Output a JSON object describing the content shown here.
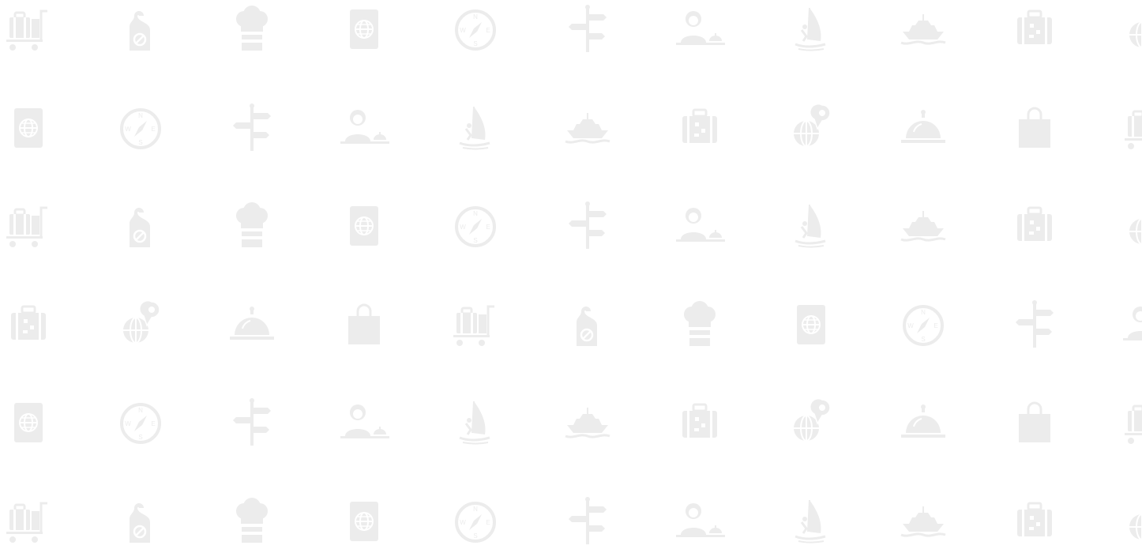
{
  "background": {
    "color": "#ffffff",
    "icon_color": "#ececec"
  },
  "rows": [
    [
      "luggage-cart-icon",
      "door-hanger-icon",
      "chef-hat-icon",
      "passport-icon",
      "compass-icon",
      "signpost-icon",
      "receptionist-icon",
      "windsurfing-icon",
      "cruise-ship-icon",
      "suitcase-icon",
      "globe-pin-icon"
    ],
    [
      "passport-icon",
      "compass-icon",
      "signpost-icon",
      "receptionist-icon",
      "windsurfing-icon",
      "cruise-ship-icon",
      "suitcase-icon",
      "globe-pin-icon",
      "room-service-cloche-icon",
      "shopping-bag-icon",
      "luggage-cart-icon"
    ],
    [
      "luggage-cart-icon",
      "door-hanger-icon",
      "chef-hat-icon",
      "passport-icon",
      "compass-icon",
      "signpost-icon",
      "receptionist-icon",
      "windsurfing-icon",
      "cruise-ship-icon",
      "suitcase-icon",
      "globe-pin-icon"
    ],
    [
      "suitcase-icon",
      "globe-pin-icon",
      "room-service-cloche-icon",
      "shopping-bag-icon",
      "luggage-cart-icon",
      "door-hanger-icon",
      "chef-hat-icon",
      "passport-icon",
      "compass-icon",
      "signpost-icon",
      "receptionist-icon"
    ],
    [
      "passport-icon",
      "compass-icon",
      "signpost-icon",
      "receptionist-icon",
      "windsurfing-icon",
      "cruise-ship-icon",
      "suitcase-icon",
      "globe-pin-icon",
      "room-service-cloche-icon",
      "shopping-bag-icon",
      "luggage-cart-icon"
    ],
    [
      "luggage-cart-icon",
      "door-hanger-icon",
      "chef-hat-icon",
      "passport-icon",
      "compass-icon",
      "signpost-icon",
      "receptionist-icon",
      "windsurfing-icon",
      "cruise-ship-icon",
      "suitcase-icon",
      "globe-pin-icon"
    ]
  ]
}
